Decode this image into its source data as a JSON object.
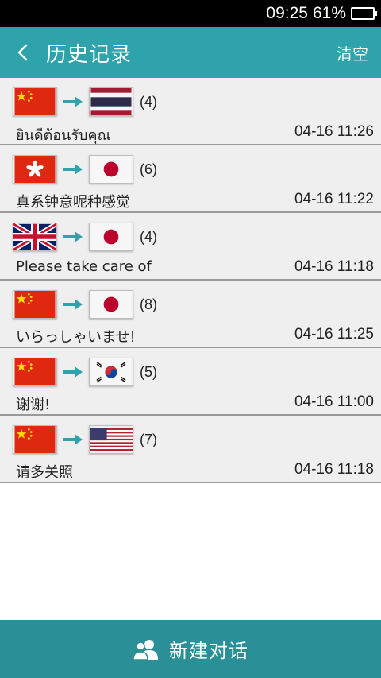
{
  "status": {
    "time": "09:25",
    "battery": "61%",
    "battery_level": 0.61
  },
  "header": {
    "title": "历史记录",
    "clear_label": "清空"
  },
  "history": [
    {
      "from": "cn",
      "to": "th",
      "count": "(4)",
      "phrase": "ยินดีต้อนรับคุณ",
      "time": "04-16 11:26"
    },
    {
      "from": "hk",
      "to": "jp",
      "count": "(6)",
      "phrase": "真系钟意呢种感觉",
      "time": "04-16 11:22"
    },
    {
      "from": "gb",
      "to": "jp",
      "count": "(4)",
      "phrase": "Please take care of",
      "time": "04-16 11:18"
    },
    {
      "from": "cn",
      "to": "jp",
      "count": "(8)",
      "phrase": "いらっしゃいませ!",
      "time": "04-16 11:25"
    },
    {
      "from": "cn",
      "to": "kr",
      "count": "(5)",
      "phrase": "谢谢!",
      "time": "04-16 11:00"
    },
    {
      "from": "cn",
      "to": "us",
      "count": "(7)",
      "phrase": "请多关照",
      "time": "04-16 11:18"
    }
  ],
  "footer": {
    "new_chat_label": "新建对话"
  },
  "colors": {
    "accent": "#2fa3ab",
    "footer": "#2a8f96",
    "row_bg": "#efefef",
    "arrow": "#2fa3ab"
  }
}
